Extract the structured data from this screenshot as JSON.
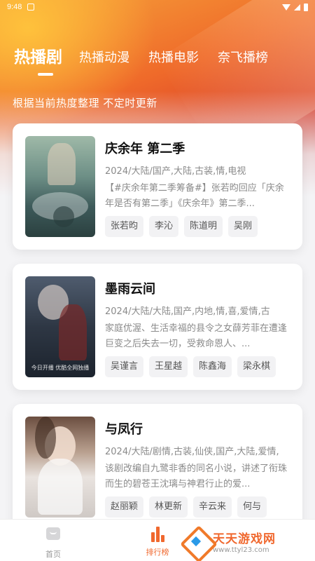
{
  "status_bar": {
    "time": "9:48"
  },
  "tabs": [
    {
      "label": "热播剧",
      "active": true
    },
    {
      "label": "热播动漫",
      "active": false
    },
    {
      "label": "热播电影",
      "active": false
    },
    {
      "label": "奈飞播榜",
      "active": false
    }
  ],
  "subtitle": "根据当前热度整理 不定时更新",
  "cards": [
    {
      "title": "庆余年 第二季",
      "meta": "2024/大陆/国产,大陆,古装,情,电视",
      "desc": "【#庆余年第二季筹备#】张若昀回应「庆余年是否有第二季」《庆余年》第二季...",
      "tags": [
        "张若昀",
        "李沁",
        "陈道明",
        "吴刚"
      ]
    },
    {
      "title": "墨雨云间",
      "meta": "2024/大陆/大陆,国产,内地,情,喜,爱情,古",
      "desc": "家庭优渥、生活幸福的县令之女薛芳菲在遭逢巨变之后失去一切，受救命恩人、...",
      "tags": [
        "吴谨言",
        "王星越",
        "陈鑫海",
        "梁永棋"
      ],
      "poster_text": "今日开播 优酷全网独播"
    },
    {
      "title": "与凤行",
      "meta": "2024/大陆/剧情,古装,仙侠,国产,大陆,爱情,",
      "desc": "该剧改编自九鹭非香的同名小说，讲述了衔珠而生的碧苍王沈璃与神君行止的爱...",
      "tags": [
        "赵丽颖",
        "林更新",
        "辛云来",
        "何与"
      ]
    }
  ],
  "bottom_nav": [
    {
      "label": "首页",
      "icon": "home-icon"
    },
    {
      "label": "排行榜",
      "icon": "ranking-icon"
    }
  ],
  "watermark": {
    "name": "天天游戏网",
    "url": "www.ttyl23.com"
  },
  "colors": {
    "accent": "#f0682e",
    "hero_start": "#f6a43a",
    "hero_end": "#a81e2e"
  }
}
